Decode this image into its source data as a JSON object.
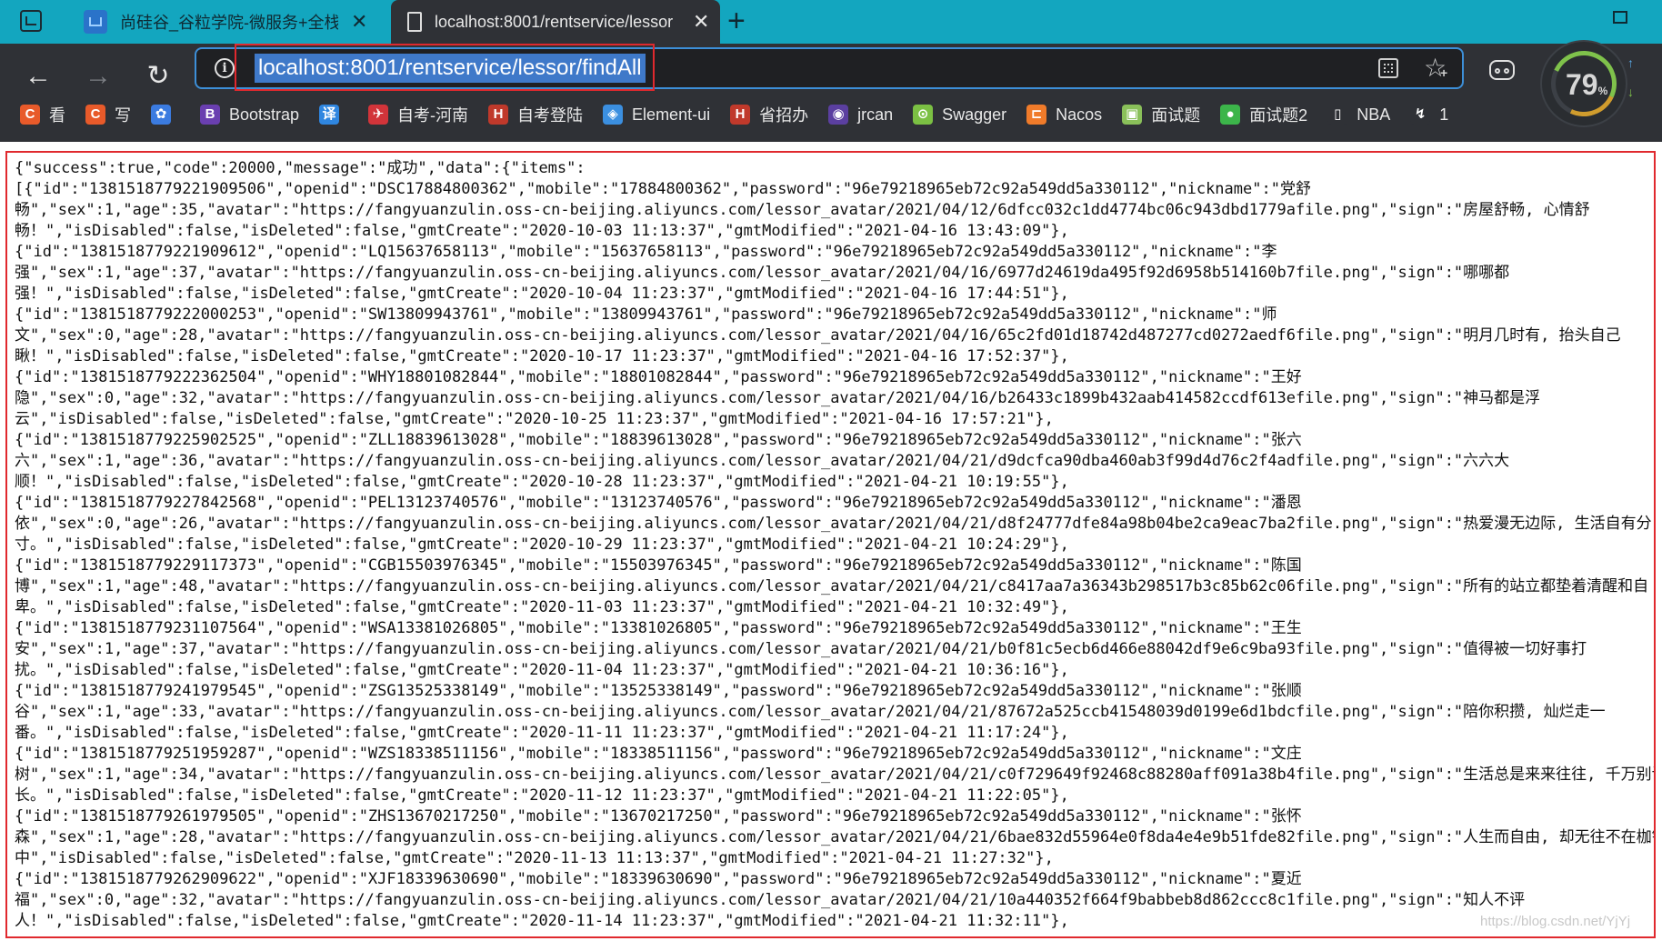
{
  "tabs": [
    {
      "title": "尚硅谷_谷粒学院-微服务+全栈在",
      "icon": "tab-doc-icon"
    },
    {
      "title": "localhost:8001/rentservice/lessor",
      "icon": "page-icon"
    }
  ],
  "address_bar": {
    "url": "localhost:8001/rentservice/lessor/findAll"
  },
  "speed_gauge": {
    "value": "79",
    "unit": "%"
  },
  "bookmarks": [
    {
      "label": "看",
      "icon": "C",
      "color": "#e85a2a"
    },
    {
      "label": "写",
      "icon": "C",
      "color": "#e85a2a"
    },
    {
      "label": "",
      "icon": "✿",
      "color": "#3b7be0"
    },
    {
      "label": "Bootstrap",
      "icon": "B",
      "color": "#6a3fb0"
    },
    {
      "label": "",
      "icon": "译",
      "color": "#2f86e0"
    },
    {
      "label": "自考-河南",
      "icon": "✈",
      "color": "#d2343a"
    },
    {
      "label": "自考登陆",
      "icon": "H",
      "color": "#c0392b"
    },
    {
      "label": "Element-ui",
      "icon": "◈",
      "color": "#3b8fe0"
    },
    {
      "label": "省招办",
      "icon": "H",
      "color": "#c0392b"
    },
    {
      "label": "jrcan",
      "icon": "◉",
      "color": "#5b3fa0"
    },
    {
      "label": "Swagger",
      "icon": "⊙",
      "color": "#7bc043"
    },
    {
      "label": "Nacos",
      "icon": "⊏",
      "color": "#f07b2a"
    },
    {
      "label": "面试题",
      "icon": "▣",
      "color": "#8ac05a"
    },
    {
      "label": "面试题2",
      "icon": "●",
      "color": "#3cb54a"
    },
    {
      "label": "NBA",
      "icon": "▯",
      "color": "#2f3136"
    },
    {
      "label": "1",
      "icon": "↯",
      "color": "#2f3136"
    }
  ],
  "json_lines": [
    "{\"success\":true,\"code\":20000,\"message\":\"成功\",\"data\":{\"items\":",
    "[{\"id\":\"1381518779221909506\",\"openid\":\"DSC17884800362\",\"mobile\":\"17884800362\",\"password\":\"96e79218965eb72c92a549dd5a330112\",\"nickname\":\"党舒",
    "畅\",\"sex\":1,\"age\":35,\"avatar\":\"https://fangyuanzulin.oss-cn-beijing.aliyuncs.com/lessor_avatar/2021/04/12/6dfcc032c1dd4774bc06c943dbd1779afile.png\",\"sign\":\"房屋舒畅, 心情舒",
    "畅！\",\"isDisabled\":false,\"isDeleted\":false,\"gmtCreate\":\"2020-10-03 11:13:37\",\"gmtModified\":\"2021-04-16 13:43:09\"},",
    "{\"id\":\"1381518779221909612\",\"openid\":\"LQ15637658113\",\"mobile\":\"15637658113\",\"password\":\"96e79218965eb72c92a549dd5a330112\",\"nickname\":\"李",
    "强\",\"sex\":1,\"age\":37,\"avatar\":\"https://fangyuanzulin.oss-cn-beijing.aliyuncs.com/lessor_avatar/2021/04/16/6977d24619da495f92d6958b514160b7file.png\",\"sign\":\"哪哪都",
    "强！\",\"isDisabled\":false,\"isDeleted\":false,\"gmtCreate\":\"2020-10-04 11:23:37\",\"gmtModified\":\"2021-04-16 17:44:51\"},",
    "{\"id\":\"1381518779222000253\",\"openid\":\"SW13809943761\",\"mobile\":\"13809943761\",\"password\":\"96e79218965eb72c92a549dd5a330112\",\"nickname\":\"师",
    "文\",\"sex\":0,\"age\":28,\"avatar\":\"https://fangyuanzulin.oss-cn-beijing.aliyuncs.com/lessor_avatar/2021/04/16/65c2fd01d18742d487277cd0272aedf6file.png\",\"sign\":\"明月几时有, 抬头自己",
    "瞅！\",\"isDisabled\":false,\"isDeleted\":false,\"gmtCreate\":\"2020-10-17 11:23:37\",\"gmtModified\":\"2021-04-16 17:52:37\"},",
    "{\"id\":\"1381518779222362504\",\"openid\":\"WHY18801082844\",\"mobile\":\"18801082844\",\"password\":\"96e79218965eb72c92a549dd5a330112\",\"nickname\":\"王好",
    "隐\",\"sex\":0,\"age\":32,\"avatar\":\"https://fangyuanzulin.oss-cn-beijing.aliyuncs.com/lessor_avatar/2021/04/16/b26433c1899b432aab414582ccdf613efile.png\",\"sign\":\"神马都是浮",
    "云\",\"isDisabled\":false,\"isDeleted\":false,\"gmtCreate\":\"2020-10-25 11:23:37\",\"gmtModified\":\"2021-04-16 17:57:21\"},",
    "{\"id\":\"1381518779225902525\",\"openid\":\"ZLL18839613028\",\"mobile\":\"18839613028\",\"password\":\"96e79218965eb72c92a549dd5a330112\",\"nickname\":\"张六",
    "六\",\"sex\":1,\"age\":36,\"avatar\":\"https://fangyuanzulin.oss-cn-beijing.aliyuncs.com/lessor_avatar/2021/04/21/d9dcfca90dba460ab3f99d4d76c2f4adfile.png\",\"sign\":\"六六大",
    "顺！\",\"isDisabled\":false,\"isDeleted\":false,\"gmtCreate\":\"2020-10-28 11:23:37\",\"gmtModified\":\"2021-04-21 10:19:55\"},",
    "{\"id\":\"1381518779227842568\",\"openid\":\"PEL13123740576\",\"mobile\":\"13123740576\",\"password\":\"96e79218965eb72c92a549dd5a330112\",\"nickname\":\"潘恩",
    "依\",\"sex\":0,\"age\":26,\"avatar\":\"https://fangyuanzulin.oss-cn-beijing.aliyuncs.com/lessor_avatar/2021/04/21/d8f24777dfe84a98b04be2ca9eac7ba2file.png\",\"sign\":\"热爱漫无边际, 生活自有分",
    "寸。\",\"isDisabled\":false,\"isDeleted\":false,\"gmtCreate\":\"2020-10-29 11:23:37\",\"gmtModified\":\"2021-04-21 10:24:29\"},",
    "{\"id\":\"1381518779229117373\",\"openid\":\"CGB15503976345\",\"mobile\":\"15503976345\",\"password\":\"96e79218965eb72c92a549dd5a330112\",\"nickname\":\"陈国",
    "博\",\"sex\":1,\"age\":48,\"avatar\":\"https://fangyuanzulin.oss-cn-beijing.aliyuncs.com/lessor_avatar/2021/04/21/c8417aa7a36343b298517b3c85b62c06file.png\",\"sign\":\"所有的站立都垫着清醒和自",
    "卑。\",\"isDisabled\":false,\"isDeleted\":false,\"gmtCreate\":\"2020-11-03 11:23:37\",\"gmtModified\":\"2021-04-21 10:32:49\"},",
    "{\"id\":\"1381518779231107564\",\"openid\":\"WSA13381026805\",\"mobile\":\"13381026805\",\"password\":\"96e79218965eb72c92a549dd5a330112\",\"nickname\":\"王生",
    "安\",\"sex\":1,\"age\":37,\"avatar\":\"https://fangyuanzulin.oss-cn-beijing.aliyuncs.com/lessor_avatar/2021/04/21/b0f81c5ecb6d466e88042df9e6c9ba93file.png\",\"sign\":\"值得被一切好事打",
    "扰。\",\"isDisabled\":false,\"isDeleted\":false,\"gmtCreate\":\"2020-11-04 11:23:37\",\"gmtModified\":\"2021-04-21 10:36:16\"},",
    "{\"id\":\"1381518779241979545\",\"openid\":\"ZSG13525338149\",\"mobile\":\"13525338149\",\"password\":\"96e79218965eb72c92a549dd5a330112\",\"nickname\":\"张顺",
    "谷\",\"sex\":1,\"age\":33,\"avatar\":\"https://fangyuanzulin.oss-cn-beijing.aliyuncs.com/lessor_avatar/2021/04/21/87672a525ccb41548039d0199e6d1bdcfile.png\",\"sign\":\"陪你积攒, 灿烂走一",
    "番。\",\"isDisabled\":false,\"isDeleted\":false,\"gmtCreate\":\"2020-11-11 11:23:37\",\"gmtModified\":\"2021-04-21 11:17:24\"},",
    "{\"id\":\"1381518779251959287\",\"openid\":\"WZS18338511156\",\"mobile\":\"18338511156\",\"password\":\"96e79218965eb72c92a549dd5a330112\",\"nickname\":\"文庄",
    "树\",\"sex\":1,\"age\":34,\"avatar\":\"https://fangyuanzulin.oss-cn-beijing.aliyuncs.com/lessor_avatar/2021/04/21/c0f729649f92468c88280aff091a38b4file.png\",\"sign\":\"生活总是来来往往, 千万别说来日方",
    "长。\",\"isDisabled\":false,\"isDeleted\":false,\"gmtCreate\":\"2020-11-12 11:23:37\",\"gmtModified\":\"2021-04-21 11:22:05\"},",
    "{\"id\":\"1381518779261979505\",\"openid\":\"ZHS13670217250\",\"mobile\":\"13670217250\",\"password\":\"96e79218965eb72c92a549dd5a330112\",\"nickname\":\"张怀",
    "森\",\"sex\":1,\"age\":28,\"avatar\":\"https://fangyuanzulin.oss-cn-beijing.aliyuncs.com/lessor_avatar/2021/04/21/6bae832d55964e0f8da4e4e9b51fde82file.png\",\"sign\":\"人生而自由, 却无往不在枷锁",
    "中\",\"isDisabled\":false,\"isDeleted\":false,\"gmtCreate\":\"2020-11-13 11:13:37\",\"gmtModified\":\"2021-04-21 11:27:32\"},",
    "{\"id\":\"1381518779262909622\",\"openid\":\"XJF18339630690\",\"mobile\":\"18339630690\",\"password\":\"96e79218965eb72c92a549dd5a330112\",\"nickname\":\"夏近",
    "福\",\"sex\":0,\"age\":32,\"avatar\":\"https://fangyuanzulin.oss-cn-beijing.aliyuncs.com/lessor_avatar/2021/04/21/10a440352f664f9babbeb8d862ccc8c1file.png\",\"sign\":\"知人不评",
    "人！\",\"isDisabled\":false,\"isDeleted\":false,\"gmtCreate\":\"2020-11-14 11:23:37\",\"gmtModified\":\"2021-04-21 11:32:11\"},"
  ],
  "watermark": "https://blog.csdn.net/YjYj"
}
